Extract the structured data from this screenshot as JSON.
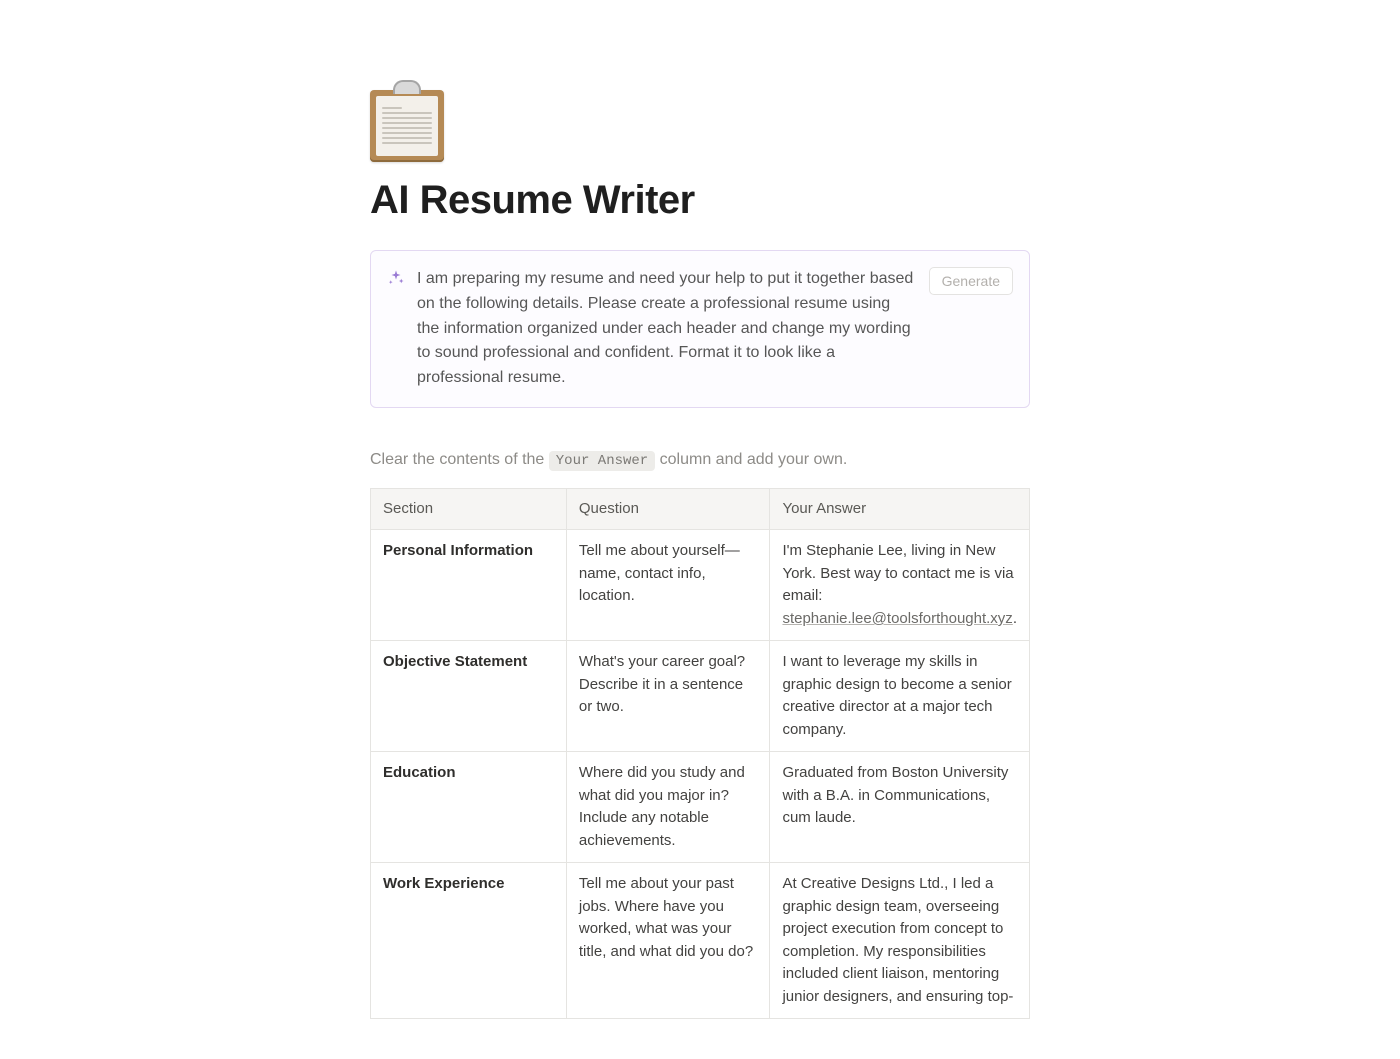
{
  "page": {
    "title": "AI Resume Writer"
  },
  "ai_block": {
    "prompt": "I am preparing my resume and need your help to put it together based on the following details. Please create a professional resume using the information organized under each header and change my wording to sound professional and confident. Format it to look like a professional resume.",
    "generate_label": "Generate"
  },
  "instruction": {
    "prefix": "Clear the contents of the ",
    "code": "Your Answer",
    "suffix": " column and add your own."
  },
  "table": {
    "headers": {
      "section": "Section",
      "question": "Question",
      "answer": "Your Answer"
    },
    "rows": [
      {
        "section": "Personal Information",
        "question": "Tell me about yourself—name, contact info, location.",
        "answer_prefix": "I'm Stephanie Lee, living in New York. Best way to contact me is via email: ",
        "answer_link": "stephanie.lee@toolsforthought.xyz",
        "answer_suffix": "."
      },
      {
        "section": "Objective Statement",
        "question": "What's your career goal? Describe it in a sentence or two.",
        "answer_prefix": "I want to leverage my skills in graphic design to become a senior creative director at a major tech company.",
        "answer_link": "",
        "answer_suffix": ""
      },
      {
        "section": "Education",
        "question": "Where did you study and what did you major in? Include any notable achievements.",
        "answer_prefix": "Graduated from Boston University with a B.A. in Communications, cum laude.",
        "answer_link": "",
        "answer_suffix": ""
      },
      {
        "section": "Work Experience",
        "question": "Tell me about your past jobs. Where have you worked, what was your title, and what did you do?",
        "answer_prefix": "At Creative Designs Ltd., I led a graphic design team, overseeing project execution from concept to completion. My responsibilities included client liaison, mentoring junior designers, and ensuring top-",
        "answer_link": "",
        "answer_suffix": ""
      }
    ]
  }
}
